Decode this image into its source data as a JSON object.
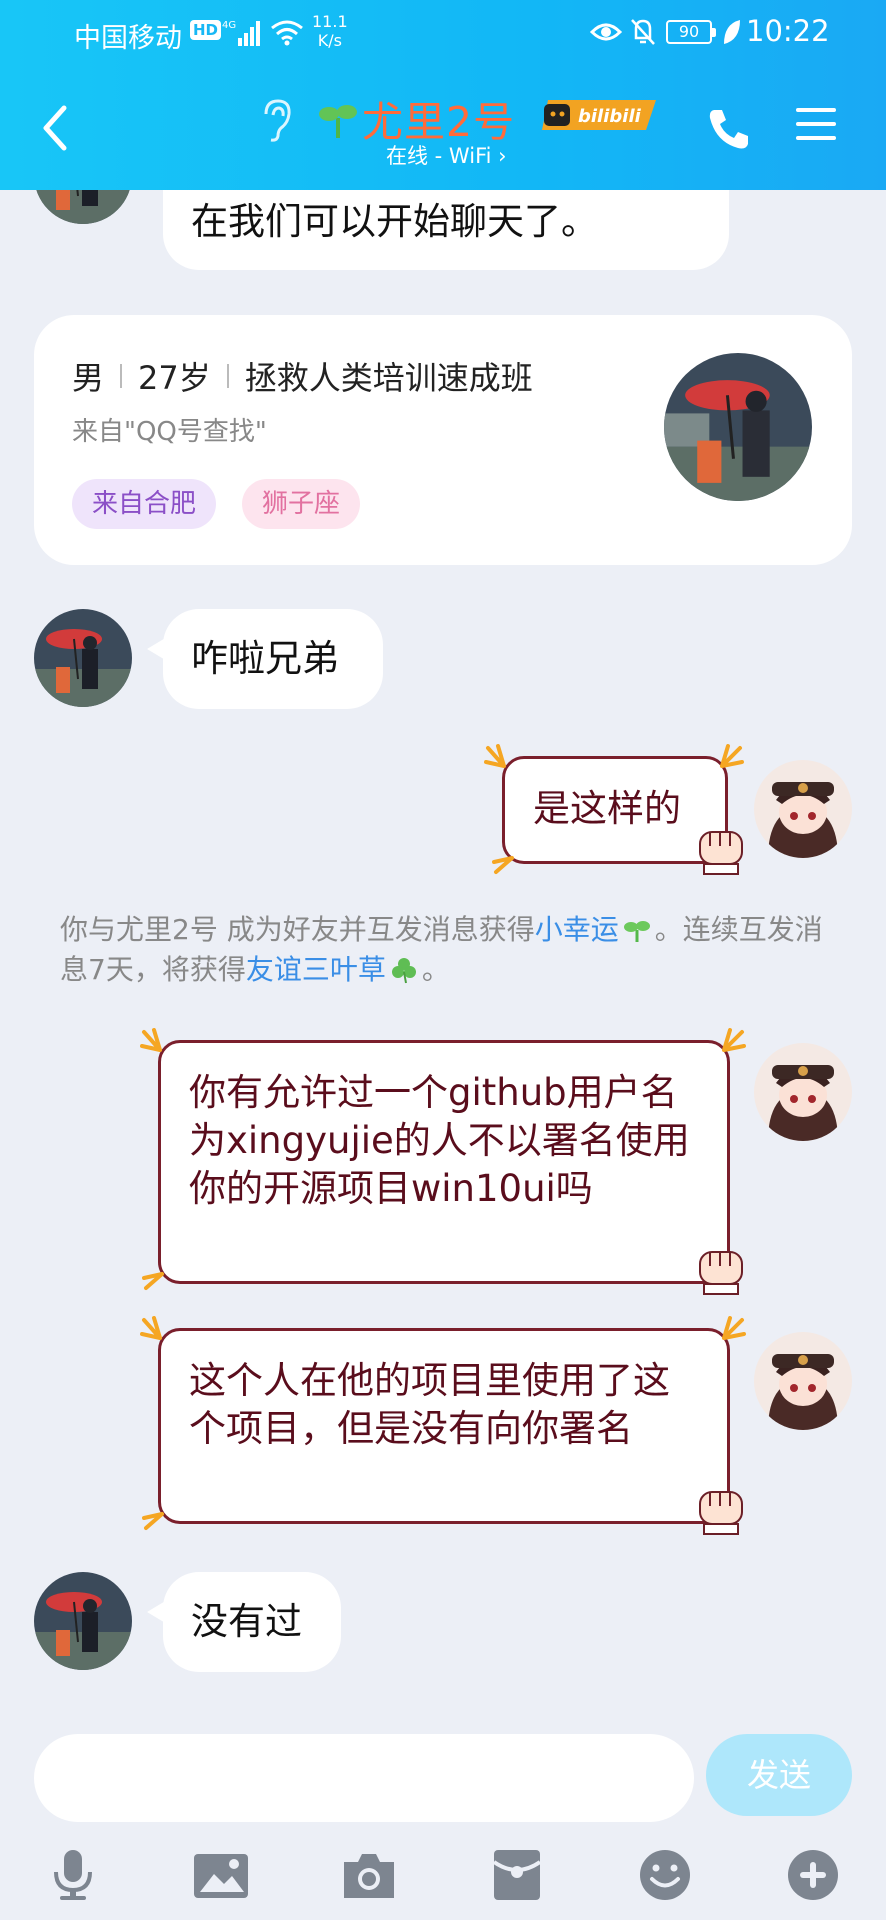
{
  "status_bar": {
    "carrier": "中国移动",
    "hd": "HD",
    "network": "4G",
    "speed_value": "11.1",
    "speed_unit": "K/s",
    "battery": "90",
    "time": "10:22"
  },
  "header": {
    "name": "尤里2号",
    "badge": "bilibili",
    "status": "在线 - WiFi ›"
  },
  "messages": {
    "friend_added_tail": "在我们可以开始聊天了。",
    "m1": "咋啦兄弟",
    "m2": "是这样的",
    "m3": "你有允许过一个github用户名为xingyujie的人不以署名使用你的开源项目win10ui吗",
    "m4": "这个人在他的项目里使用了这个项目，但是没有向你署名",
    "m5": "没有过"
  },
  "profile": {
    "gender": "男",
    "age": "27岁",
    "title": "拯救人类培训速成班",
    "source": "来自\"QQ号查找\"",
    "tags": [
      "来自合肥",
      "狮子座"
    ]
  },
  "system": {
    "prefix": "你与尤里2号 成为好友并互发消息获得",
    "luck": "小幸运",
    "middle": "。连续互发消息7天，将获得",
    "clover": "友谊三叶草",
    "suffix": "。"
  },
  "input": {
    "placeholder": "",
    "send": "发送"
  },
  "toolbar": [
    "microphone-icon",
    "image-icon",
    "camera-icon",
    "red-packet-icon",
    "emoji-icon",
    "plus-icon"
  ],
  "colors": {
    "header_bg": "#18c6f7",
    "name": "#ff6b3a",
    "bubble_out_border": "#7a1f2c",
    "link": "#3a8ee6",
    "send_disabled": "#aee7fb"
  }
}
